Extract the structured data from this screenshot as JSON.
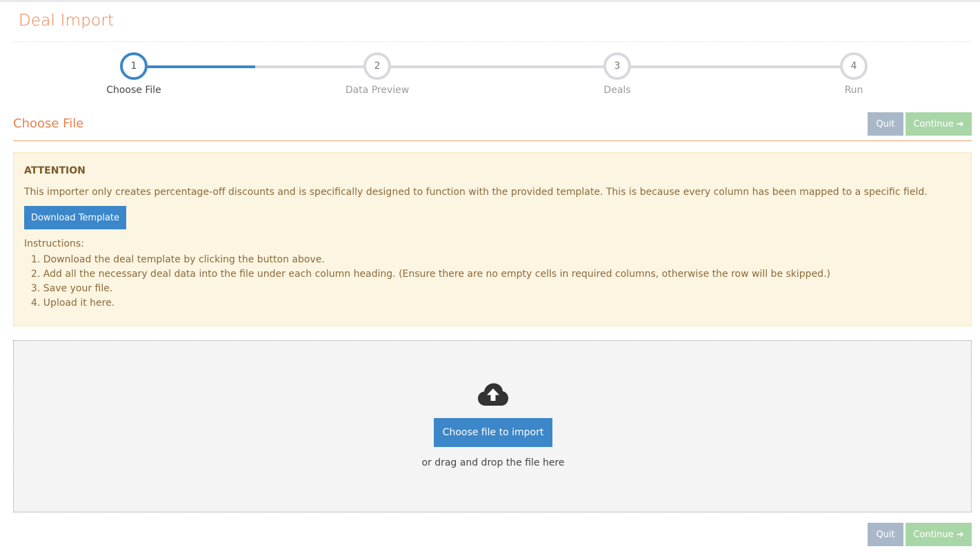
{
  "page": {
    "title": "Deal Import"
  },
  "stepper": {
    "steps": [
      {
        "number": "1",
        "label": "Choose File",
        "state": "active"
      },
      {
        "number": "2",
        "label": "Data Preview",
        "state": "inactive"
      },
      {
        "number": "3",
        "label": "Deals",
        "state": "inactive"
      },
      {
        "number": "4",
        "label": "Run",
        "state": "inactive"
      }
    ]
  },
  "section": {
    "title": "Choose File"
  },
  "actions": {
    "quit_label": "Quit",
    "continue_label": "Continue",
    "continue_icon": "arrow-right-icon"
  },
  "attention": {
    "heading": "ATTENTION",
    "text": "This importer only creates percentage-off discounts and is specifically designed to function with the provided template. This is because every column has been mapped to a specific field.",
    "download_label": "Download Template",
    "instructions_heading": "Instructions:",
    "instructions": [
      "1. Download the deal template by clicking the button above.",
      "2. Add all the necessary deal data into the file under each column heading. (Ensure there are no empty cells in required columns, otherwise the row will be skipped.)",
      "3. Save your file.",
      "4. Upload it here."
    ]
  },
  "dropzone": {
    "icon": "cloud-upload-icon",
    "button_label": "Choose file to import",
    "hint": "or drag and drop the file here"
  },
  "colors": {
    "accent": "#e8804a",
    "primary": "#3b87c9",
    "quit": "#a8b8c8",
    "continue": "#a9d6a7",
    "attention_bg": "#fcf5e2"
  }
}
